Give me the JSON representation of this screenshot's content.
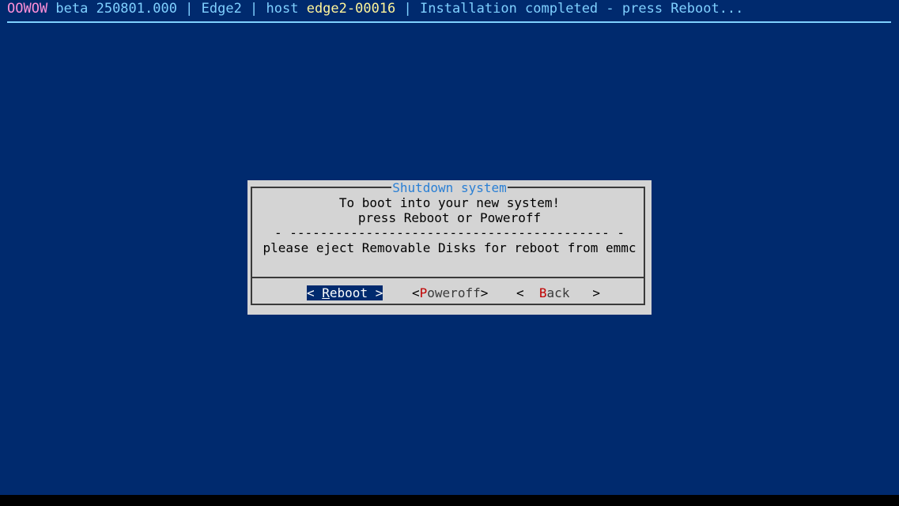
{
  "header": {
    "product": "OOWOW",
    "version_text": " beta 250801.000 | Edge2 | host ",
    "hostname": "edge2-00016",
    "status": " | Installation completed - press Reboot...",
    "colors": {
      "product": "#ff8fd8",
      "text": "#7fd0ff",
      "hostname": "#fff59a"
    }
  },
  "dialog": {
    "title": "Shutdown system",
    "lines": [
      "To boot into your new system!",
      "press Reboot or Poweroff",
      "- ------------------------------------------ -",
      "please eject Removable Disks for reboot from emmc"
    ],
    "buttons": {
      "reboot": {
        "open": "< ",
        "hotkey": "R",
        "rest": "eboot",
        "close": " >",
        "selected": true
      },
      "poweroff": {
        "open": "<",
        "hotkey": "P",
        "rest": "oweroff",
        "close": ">"
      },
      "back": {
        "open": "<  ",
        "hotkey": "B",
        "rest": "ack",
        "close": "   >"
      }
    }
  },
  "colors": {
    "background": "#002a6e",
    "dialog_bg": "#d4d4d4",
    "title": "#2a7fd4",
    "hotkey": "#c00000"
  }
}
